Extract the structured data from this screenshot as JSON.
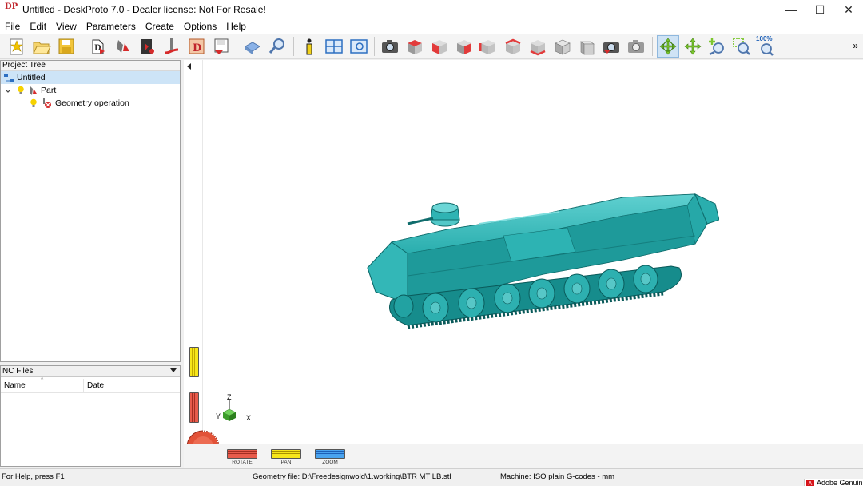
{
  "window": {
    "title": "Untitled - DeskProto 7.0 - Dealer license: Not For Resale!",
    "app_icon_text": "DP",
    "minimize_glyph": "—",
    "maximize_glyph": "☐",
    "close_glyph": "✕"
  },
  "menu": {
    "items": [
      "File",
      "Edit",
      "View",
      "Parameters",
      "Create",
      "Options",
      "Help"
    ]
  },
  "toolbar": {
    "groups": [
      [
        "new-project-icon",
        "open-project-icon",
        "save-project-icon"
      ],
      [
        "part-wizard-icon",
        "import-geometry-icon",
        "cutter-wizard-icon",
        "tool-path-icon",
        "design-icon",
        "save-nc-icon"
      ],
      [
        "machine-icon",
        "inspect-icon"
      ],
      [
        "info-icon",
        "viewports-icon",
        "preview-icon"
      ],
      [
        "camera-icon",
        "view-top-icon",
        "view-front-icon",
        "view-right-icon",
        "view-left-icon",
        "view-back-icon",
        "view-bottom-icon",
        "view-iso-icon",
        "view-iso2-icon",
        "render-icon",
        "render-toolpath-icon"
      ],
      [
        "rotate-icon",
        "pan-icon",
        "zoom-in-icon",
        "zoom-window-icon",
        "zoom-100-icon"
      ]
    ],
    "zoom_100_label": "100%",
    "more_glyph": "»"
  },
  "project_tree": {
    "header": "Project Tree",
    "items": [
      {
        "label": "Untitled",
        "icon": "project-icon",
        "level": 0,
        "selected": true
      },
      {
        "label": "Part",
        "icon": "part-icon",
        "level": 1,
        "selected": false
      },
      {
        "label": "Geometry operation",
        "icon": "geometry-operation-icon",
        "level": 2,
        "selected": false
      }
    ]
  },
  "nc_files": {
    "header": "NC Files",
    "columns": [
      "Name",
      "Date"
    ]
  },
  "viewport": {
    "model_color": "#2aaeae",
    "axis_labels": {
      "x": "X",
      "y": "Y",
      "z": "Z"
    },
    "controls": {
      "rotate": "ROTATE",
      "pan": "PAN",
      "zoom": "ZOOM"
    }
  },
  "status": {
    "help": "For Help, press F1",
    "geometry": "Geometry file: D:\\Freedesignwold\\1.working\\BTR MT LB.stl",
    "machine": "Machine: ISO plain G-codes - mm",
    "taskbar_app": "Adobe Genuin"
  }
}
